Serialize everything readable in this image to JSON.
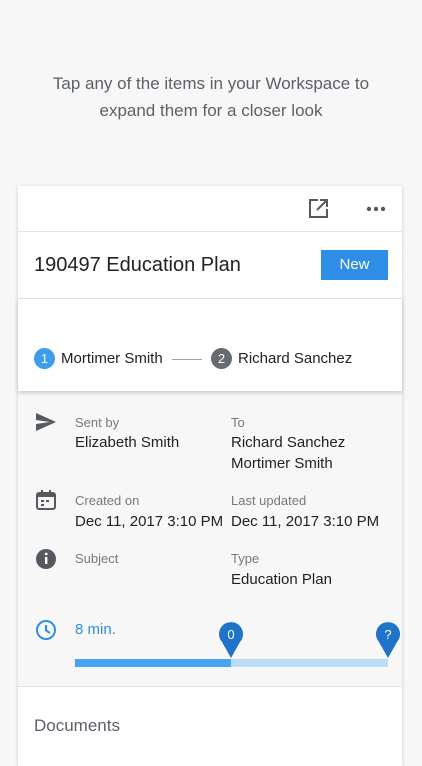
{
  "intro": {
    "line1": "Tap any of the items in your Workspace to",
    "line2": "expand them for a closer look"
  },
  "card": {
    "title": "190497 Education Plan",
    "badge": "New",
    "signers": [
      {
        "number": "1",
        "name": "Mortimer Smith"
      },
      {
        "number": "2",
        "name": "Richard Sanchez"
      }
    ],
    "sent_by": {
      "label": "Sent by",
      "value": "Elizabeth Smith"
    },
    "to": {
      "label": "To",
      "values": [
        "Richard Sanchez",
        "Mortimer Smith"
      ]
    },
    "created": {
      "label": "Created on",
      "value": "Dec 11, 2017 3:10 PM"
    },
    "updated": {
      "label": "Last updated",
      "value": "Dec 11, 2017 3:10 PM"
    },
    "subject": {
      "label": "Subject",
      "value": ""
    },
    "type": {
      "label": "Type",
      "value": "Education Plan"
    },
    "timer": {
      "label": "8 min.",
      "progress": 0.5,
      "start_pin": "0",
      "end_pin": "?"
    },
    "documents_label": "Documents"
  },
  "colors": {
    "accent": "#2e8ee6",
    "progress_fill": "#49a3f2",
    "progress_track": "#bfdcf7"
  }
}
